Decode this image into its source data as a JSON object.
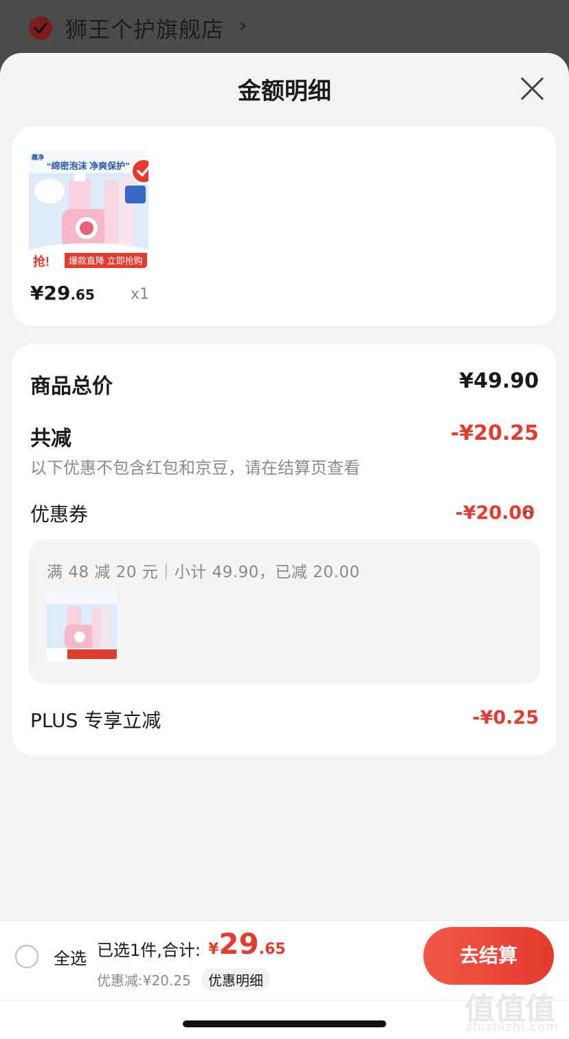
{
  "store": {
    "name": "狮王个护旗舰店",
    "chevron": "›",
    "check_icon": "check-circle-icon"
  },
  "sheet": {
    "title": "金额明细",
    "close_icon": "close-icon"
  },
  "product": {
    "price_int": "¥29",
    "price_dec": ".65",
    "qty": "x1",
    "thumb": {
      "brand": "趣净",
      "slogan": "“绵密泡沫 净爽保护”",
      "badge": "抢!",
      "banner": "爆款直降 立即抢购"
    }
  },
  "detail": {
    "total_label": "商品总价",
    "total_value": "¥49.90",
    "reduce_label": "共减",
    "reduce_value": "-¥20.25",
    "note": "以下优惠不包含红包和京豆，请在结算页查看",
    "coupon_label": "优惠券",
    "coupon_value": "-¥20.00",
    "coupon_chevron": "^",
    "coupon_desc": "满 48 减 20 元｜小计 49.90，已减 20.00",
    "plus_label": "PLUS 专享立减",
    "plus_value": "-¥0.25"
  },
  "bottom": {
    "select_all": "全选",
    "summary": "已选1件,合计:",
    "total_currency": "¥",
    "total_int": "29",
    "total_dec": ".65",
    "discount": "优惠减:¥20.25",
    "detail_link": "优惠明细",
    "checkout": "去结算"
  },
  "watermark": {
    "glyphs": "值值值",
    "url": "zhizhizhi.com"
  },
  "colors": {
    "accent": "#e23c2f",
    "sheet_bg": "#f3f3f3",
    "overlay": "#4b4b4b"
  }
}
